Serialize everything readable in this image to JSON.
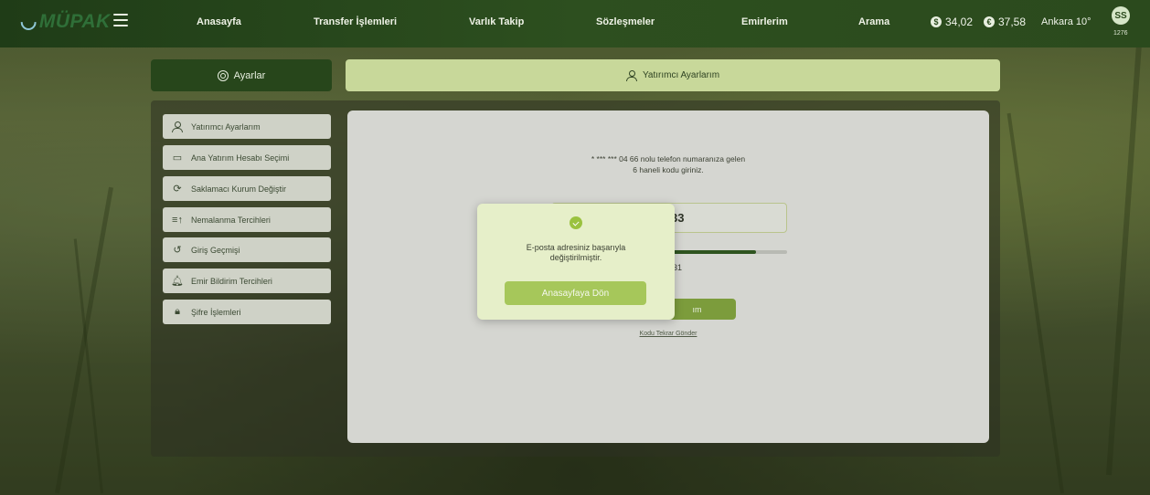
{
  "topnav": {
    "logo_text": "MÜPAK",
    "menu": [
      "Anasayfa",
      "Transfer İşlemleri",
      "Varlık Takip",
      "Sözleşmeler",
      "Emirlerim",
      "Arama"
    ],
    "fx": [
      {
        "symbol": "$",
        "value": "34,02"
      },
      {
        "symbol": "€",
        "value": "37,58"
      }
    ],
    "weather": "Ankara 10°",
    "avatar_initials": "SS",
    "avatar_code": "1276"
  },
  "header": {
    "settings_label": "Ayarlar",
    "active_section": "Yatırımcı Ayarlarım"
  },
  "sidebar": {
    "items": [
      {
        "label": "Yatırımcı Ayarlarım",
        "icon": "user-icon"
      },
      {
        "label": "Ana Yatırım Hesabı Seçimi",
        "icon": "account-icon"
      },
      {
        "label": "Saklamacı Kurum Değiştir",
        "icon": "refresh-icon"
      },
      {
        "label": "Nemalanma Tercihleri",
        "icon": "sort-icon"
      },
      {
        "label": "Giriş Geçmişi",
        "icon": "history-icon"
      },
      {
        "label": "Emir Bildirim Tercihleri",
        "icon": "bell-icon"
      },
      {
        "label": "Şifre İşlemleri",
        "icon": "lock-icon"
      }
    ]
  },
  "verify": {
    "line1": "* *** *** 04 66 nolu telefon numaranıza gelen",
    "line2": "6 haneli kodu giriniz.",
    "code_visible": "33",
    "timer_visible": "31",
    "progress": 0.87,
    "confirm_visible": "ım",
    "resend_label": "Kodu Tekrar Gönder"
  },
  "modal": {
    "message_line1": "E-posta adresiniz başarıyla",
    "message_line2": "değiştirilmiştir.",
    "button_label": "Anasayfaya Dön"
  }
}
